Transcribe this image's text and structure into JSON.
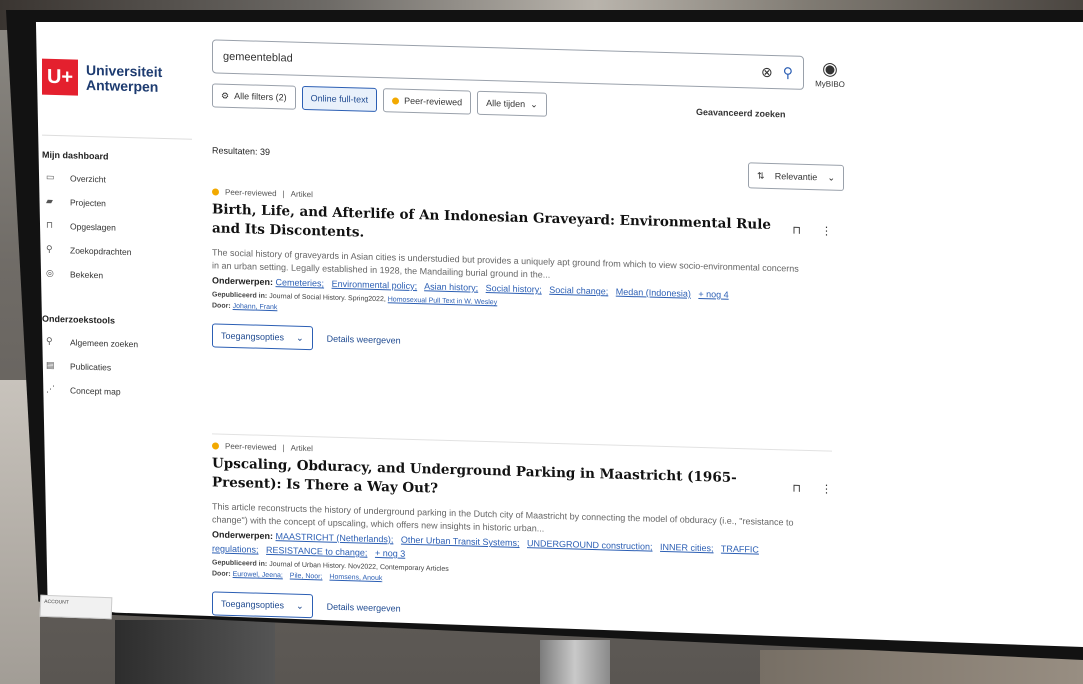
{
  "logo": {
    "mark": "U+",
    "line1": "Universiteit",
    "line2": "Antwerpen"
  },
  "search": {
    "value": "gemeenteblad"
  },
  "account": {
    "label": "MyBIBO"
  },
  "filters": {
    "all": "Alle filters (2)",
    "fulltext": "Online full-text",
    "peer": "Peer-reviewed",
    "time": "Alle tijden",
    "advanced": "Geavanceerd zoeken"
  },
  "sidebar": {
    "dashboard_heading": "Mijn dashboard",
    "dashboard_items": [
      {
        "label": "Overzicht",
        "icon": "grid-icon"
      },
      {
        "label": "Projecten",
        "icon": "folder-icon"
      },
      {
        "label": "Opgeslagen",
        "icon": "bookmark-icon"
      },
      {
        "label": "Zoekopdrachten",
        "icon": "search-icon"
      },
      {
        "label": "Bekeken",
        "icon": "eye-icon"
      }
    ],
    "tools_heading": "Onderzoekstools",
    "tools_items": [
      {
        "label": "Algemeen zoeken",
        "icon": "search-icon"
      },
      {
        "label": "Publicaties",
        "icon": "document-icon"
      },
      {
        "label": "Concept map",
        "icon": "map-icon"
      }
    ]
  },
  "results": {
    "count": "Resultaten: 39",
    "sort": "Relevantie",
    "items": [
      {
        "badge": "Peer-reviewed",
        "type": "Artikel",
        "title": "Birth, Life, and Afterlife of An Indonesian Graveyard: Environmental Rule and Its Discontents.",
        "abstract": "The social history of graveyards in Asian cities is understudied but provides a uniquely apt ground from which to view socio-environmental concerns in an urban setting. Legally established in 1928, the Mandailing burial ground in the...",
        "subjects_label": "Onderwerpen:",
        "subjects": [
          "Cemeteries;",
          "Environmental policy;",
          "Asian history;",
          "Social history;",
          "Social change;",
          "Medan (Indonesia)"
        ],
        "more": "+ nog 4",
        "published_label": "Gepubliceerd in:",
        "published": "Journal of Social History. Spring2022,",
        "published_link": "Homosexual Pull Text in W. Wesley",
        "by_label": "Door:",
        "authors": [
          "Johann, Frank"
        ],
        "access": "Toegangsopties",
        "details": "Details weergeven"
      },
      {
        "badge": "Peer-reviewed",
        "type": "Artikel",
        "title": "Upscaling, Obduracy, and Underground Parking in Maastricht (1965-Present): Is There a Way Out?",
        "abstract": "This article reconstructs the history of underground parking in the Dutch city of Maastricht by connecting the model of obduracy (i.e., \"resistance to change\") with the concept of upscaling, which offers new insights in historic urban...",
        "subjects_label": "Onderwerpen:",
        "subjects": [
          "MAASTRICHT (Netherlands);",
          "Other Urban Transit Systems;",
          "UNDERGROUND construction;",
          "INNER cities;",
          "TRAFFIC regulations;",
          "RESISTANCE to change;"
        ],
        "more": "+ nog 3",
        "published_label": "Gepubliceerd in:",
        "published": "Journal of Urban History. Nov2022, Contemporary Articles",
        "by_label": "Door:",
        "authors": [
          "Eurowel, Jeena;",
          "Pile, Noor;",
          "Homsens, Anouk"
        ],
        "access": "Toegangsopties",
        "details": "Details weergeven"
      }
    ]
  },
  "taskbar": {
    "label": "ACCOUNT"
  }
}
